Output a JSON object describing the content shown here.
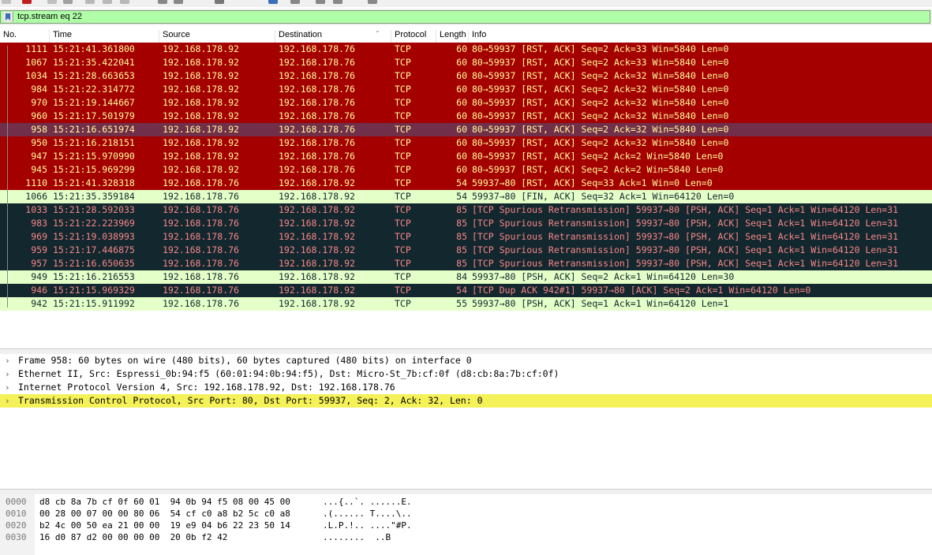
{
  "toolbar": {
    "icons": [
      "open-icon",
      "close-icon",
      "reload-icon",
      "options-icon",
      "go-back-icon",
      "go-forward-icon",
      "jump-icon",
      "first-icon",
      "last-icon",
      "autoscroll-icon",
      "colorize-icon",
      "zoom-in-icon",
      "zoom-out-icon",
      "normal-size-icon",
      "resize-columns-icon"
    ]
  },
  "filter": {
    "value": "tcp.stream eq 22"
  },
  "columns": {
    "no": "No.",
    "time": "Time",
    "source": "Source",
    "destination": "Destination",
    "protocol": "Protocol",
    "length": "Length",
    "info": "Info"
  },
  "packets": [
    {
      "no": "1111",
      "time": "15:21:41.361800",
      "src": "192.168.178.92",
      "dst": "192.168.178.76",
      "proto": "TCP",
      "len": "60",
      "info": "80→59937 [RST, ACK] Seq=2 Ack=33 Win=5840 Len=0",
      "style": "rst"
    },
    {
      "no": "1067",
      "time": "15:21:35.422041",
      "src": "192.168.178.92",
      "dst": "192.168.178.76",
      "proto": "TCP",
      "len": "60",
      "info": "80→59937 [RST, ACK] Seq=2 Ack=33 Win=5840 Len=0",
      "style": "rst"
    },
    {
      "no": "1034",
      "time": "15:21:28.663653",
      "src": "192.168.178.92",
      "dst": "192.168.178.76",
      "proto": "TCP",
      "len": "60",
      "info": "80→59937 [RST, ACK] Seq=2 Ack=32 Win=5840 Len=0",
      "style": "rst"
    },
    {
      "no": "984",
      "time": "15:21:22.314772",
      "src": "192.168.178.92",
      "dst": "192.168.178.76",
      "proto": "TCP",
      "len": "60",
      "info": "80→59937 [RST, ACK] Seq=2 Ack=32 Win=5840 Len=0",
      "style": "rst"
    },
    {
      "no": "970",
      "time": "15:21:19.144667",
      "src": "192.168.178.92",
      "dst": "192.168.178.76",
      "proto": "TCP",
      "len": "60",
      "info": "80→59937 [RST, ACK] Seq=2 Ack=32 Win=5840 Len=0",
      "style": "rst"
    },
    {
      "no": "960",
      "time": "15:21:17.501979",
      "src": "192.168.178.92",
      "dst": "192.168.178.76",
      "proto": "TCP",
      "len": "60",
      "info": "80→59937 [RST, ACK] Seq=2 Ack=32 Win=5840 Len=0",
      "style": "rst"
    },
    {
      "no": "958",
      "time": "15:21:16.651974",
      "src": "192.168.178.92",
      "dst": "192.168.178.76",
      "proto": "TCP",
      "len": "60",
      "info": "80→59937 [RST, ACK] Seq=2 Ack=32 Win=5840 Len=0",
      "style": "sel"
    },
    {
      "no": "950",
      "time": "15:21:16.218151",
      "src": "192.168.178.92",
      "dst": "192.168.178.76",
      "proto": "TCP",
      "len": "60",
      "info": "80→59937 [RST, ACK] Seq=2 Ack=32 Win=5840 Len=0",
      "style": "rst"
    },
    {
      "no": "947",
      "time": "15:21:15.970990",
      "src": "192.168.178.92",
      "dst": "192.168.178.76",
      "proto": "TCP",
      "len": "60",
      "info": "80→59937 [RST, ACK] Seq=2 Ack=2 Win=5840 Len=0",
      "style": "rst"
    },
    {
      "no": "945",
      "time": "15:21:15.969299",
      "src": "192.168.178.92",
      "dst": "192.168.178.76",
      "proto": "TCP",
      "len": "60",
      "info": "80→59937 [RST, ACK] Seq=2 Ack=2 Win=5840 Len=0",
      "style": "rst"
    },
    {
      "no": "1110",
      "time": "15:21:41.328318",
      "src": "192.168.178.76",
      "dst": "192.168.178.92",
      "proto": "TCP",
      "len": "54",
      "info": "59937→80 [RST, ACK] Seq=33 Ack=1 Win=0 Len=0",
      "style": "rst"
    },
    {
      "no": "1066",
      "time": "15:21:35.359184",
      "src": "192.168.178.76",
      "dst": "192.168.178.92",
      "proto": "TCP",
      "len": "54",
      "info": "59937→80 [FIN, ACK] Seq=32 Ack=1 Win=64120 Len=0",
      "style": "green"
    },
    {
      "no": "1033",
      "time": "15:21:28.592033",
      "src": "192.168.178.76",
      "dst": "192.168.178.92",
      "proto": "TCP",
      "len": "85",
      "info": "[TCP Spurious Retransmission] 59937→80 [PSH, ACK] Seq=1 Ack=1 Win=64120 Len=31",
      "style": "dark"
    },
    {
      "no": "983",
      "time": "15:21:22.223969",
      "src": "192.168.178.76",
      "dst": "192.168.178.92",
      "proto": "TCP",
      "len": "85",
      "info": "[TCP Spurious Retransmission] 59937→80 [PSH, ACK] Seq=1 Ack=1 Win=64120 Len=31",
      "style": "dark"
    },
    {
      "no": "969",
      "time": "15:21:19.038993",
      "src": "192.168.178.76",
      "dst": "192.168.178.92",
      "proto": "TCP",
      "len": "85",
      "info": "[TCP Spurious Retransmission] 59937→80 [PSH, ACK] Seq=1 Ack=1 Win=64120 Len=31",
      "style": "dark"
    },
    {
      "no": "959",
      "time": "15:21:17.446875",
      "src": "192.168.178.76",
      "dst": "192.168.178.92",
      "proto": "TCP",
      "len": "85",
      "info": "[TCP Spurious Retransmission] 59937→80 [PSH, ACK] Seq=1 Ack=1 Win=64120 Len=31",
      "style": "dark"
    },
    {
      "no": "957",
      "time": "15:21:16.650635",
      "src": "192.168.178.76",
      "dst": "192.168.178.92",
      "proto": "TCP",
      "len": "85",
      "info": "[TCP Spurious Retransmission] 59937→80 [PSH, ACK] Seq=1 Ack=1 Win=64120 Len=31",
      "style": "dark"
    },
    {
      "no": "949",
      "time": "15:21:16.216553",
      "src": "192.168.178.76",
      "dst": "192.168.178.92",
      "proto": "TCP",
      "len": "84",
      "info": "59937→80 [PSH, ACK] Seq=2 Ack=1 Win=64120 Len=30",
      "style": "green"
    },
    {
      "no": "946",
      "time": "15:21:15.969329",
      "src": "192.168.178.76",
      "dst": "192.168.178.92",
      "proto": "TCP",
      "len": "54",
      "info": "[TCP Dup ACK 942#1] 59937→80 [ACK] Seq=2 Ack=1 Win=64120 Len=0",
      "style": "dark"
    },
    {
      "no": "942",
      "time": "15:21:15.911992",
      "src": "192.168.178.76",
      "dst": "192.168.178.92",
      "proto": "TCP",
      "len": "55",
      "info": "59937→80 [PSH, ACK] Seq=1 Ack=1 Win=64120 Len=1",
      "style": "green"
    }
  ],
  "details": [
    {
      "text": "Frame 958: 60 bytes on wire (480 bits), 60 bytes captured (480 bits) on interface 0",
      "highlight": false
    },
    {
      "text": "Ethernet II, Src: Espressi_0b:94:f5 (60:01:94:0b:94:f5), Dst: Micro-St_7b:cf:0f (d8:cb:8a:7b:cf:0f)",
      "highlight": false
    },
    {
      "text": "Internet Protocol Version 4, Src: 192.168.178.92, Dst: 192.168.178.76",
      "highlight": false
    },
    {
      "text": "Transmission Control Protocol, Src Port: 80, Dst Port: 59937, Seq: 2, Ack: 32, Len: 0",
      "highlight": true
    }
  ],
  "bytes": [
    {
      "offset": "0000",
      "hex": "d8 cb 8a 7b cf 0f 60 01  94 0b 94 f5 08 00 45 00",
      "ascii": "...{..`. ......E."
    },
    {
      "offset": "0010",
      "hex": "00 28 00 07 00 00 80 06  54 cf c0 a8 b2 5c c0 a8",
      "ascii": ".(...... T....\\.."
    },
    {
      "offset": "0020",
      "hex": "b2 4c 00 50 ea 21 00 00  19 e9 04 b6 22 23 50 14",
      "ascii": ".L.P.!.. ....\"#P."
    },
    {
      "offset": "0030",
      "hex": "16 d0 87 d2 00 00 00 00  20 0b f2 42",
      "ascii": "........  ..B"
    }
  ]
}
